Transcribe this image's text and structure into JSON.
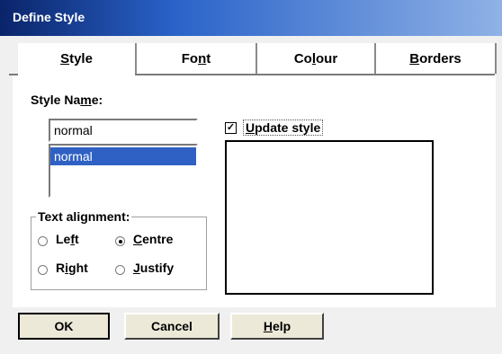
{
  "window": {
    "title": "Define Style"
  },
  "tabs": [
    {
      "label": "Style",
      "mnemonic": "S"
    },
    {
      "label": "Font",
      "mnemonic": "n"
    },
    {
      "label": "Colour",
      "mnemonic": "l"
    },
    {
      "label": "Borders",
      "mnemonic": "B"
    }
  ],
  "style_tab": {
    "style_name_label": "Style Name:",
    "style_name_value": "normal",
    "list_items": [
      "normal"
    ],
    "alignment": {
      "title": "Text alignment:",
      "options": [
        "Left",
        "Centre",
        "Right",
        "Justify"
      ],
      "selected": "Centre"
    },
    "update_style": {
      "label": "Update style",
      "checked": true,
      "mark": "✓"
    }
  },
  "buttons": {
    "ok": "OK",
    "cancel": "Cancel",
    "help": "Help"
  }
}
